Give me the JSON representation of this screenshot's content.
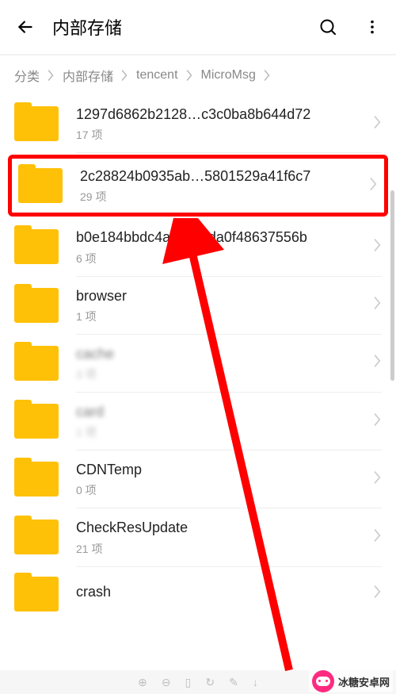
{
  "header": {
    "title": "内部存储"
  },
  "breadcrumb": {
    "items": [
      "分类",
      "内部存储",
      "tencent",
      "MicroMsg"
    ]
  },
  "folders": [
    {
      "name": "1297d6862b2128…c3c0ba8b644d72",
      "meta": "17 项",
      "highlighted": false
    },
    {
      "name": "2c28824b0935ab…5801529a41f6c7",
      "meta": "29 项",
      "highlighted": true
    },
    {
      "name": "b0e184bbdc4aeff…1da0f48637556b",
      "meta": "6 项",
      "highlighted": false
    },
    {
      "name": "browser",
      "meta": "1 项",
      "highlighted": false
    },
    {
      "name": "cache",
      "meta": "3 项",
      "highlighted": false,
      "blurred": true
    },
    {
      "name": "card",
      "meta": "1 项",
      "highlighted": false,
      "blurred": true
    },
    {
      "name": "CDNTemp",
      "meta": "0 项",
      "highlighted": false
    },
    {
      "name": "CheckResUpdate",
      "meta": "21 项",
      "highlighted": false
    },
    {
      "name": "crash",
      "meta": "",
      "highlighted": false
    }
  ],
  "watermark": {
    "text": "冰糖安卓网"
  }
}
